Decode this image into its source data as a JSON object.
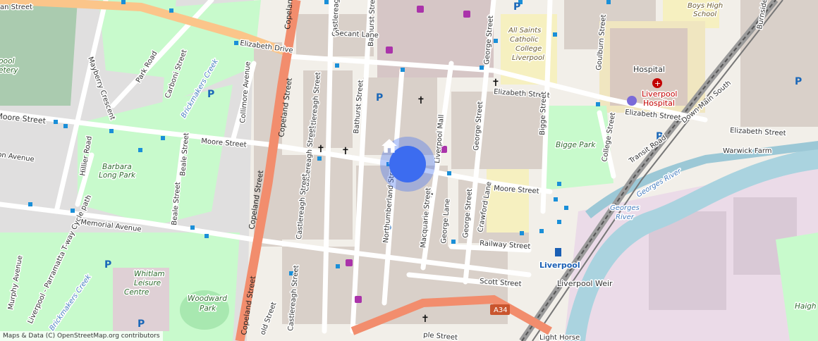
{
  "attribution": "Maps & Data (C) OpenStreetMap.org contributors",
  "colors": {
    "background": "#f2efe9",
    "park": "#c8facc",
    "building": "#d9d0c9",
    "primary_road": "#f28d6d",
    "secondary_road": "#f9d7a8",
    "water": "#aad3df",
    "rail": "#707070",
    "marker": "#3c6cf0"
  },
  "marker": {
    "icon": "home-icon"
  },
  "streets": {
    "moore_w": "Moore Street",
    "moore_c": "Moore Street",
    "moore_e": "Moore Street",
    "elizabeth_drive": "Elizabeth Drive",
    "elizabeth_c": "Elizabeth Street",
    "elizabeth_e1": "Elizabeth Street",
    "elizabeth_e2": "Elizabeth Street",
    "copeland_n": "Copeland Street",
    "copeland_c": "Copeland Street",
    "copeland_s": "Copeland Street",
    "memorial": "Memorial Avenue",
    "castlereagh_n": "Castlereagh Street",
    "castlereagh_c": "Castlereagh Street",
    "castlereagh_m": "Castlereagh Street",
    "castlereagh_s": "Castlereagh Street",
    "bathurst_n": "Bathurst Street",
    "bathurst_c": "Bathurst Street",
    "northumberland": "Northumberland Street",
    "macquarie": "Macquarie Street",
    "george_lane": "George Lane",
    "george_n": "George Street",
    "george_c": "George Street",
    "george_s": "George Street",
    "crawford": "Crawford Lane",
    "railway": "Railway Street",
    "scott": "Scott Street",
    "liverpool_mall": "Liverpool Mall",
    "secant": "Secant Lane",
    "bigge": "Bigge Street",
    "college": "College Street",
    "goulburn": "Goulburn Street",
    "burnside": "Burnside Drive",
    "mayberry": "Mayberry Crescent",
    "park_road": "Park Road",
    "carboni": "Carboni Street",
    "collimore": "Collimore Avenue",
    "hillier": "Hillier Road",
    "beale1": "Beale Street",
    "beale2": "Beale Street",
    "murphy": "Murphy Avenue",
    "avenue_w": "on Avenue",
    "street_nw": "an Street",
    "down_main_south": "Down Main South",
    "transit_road": "Transit Road",
    "warwick_farm": "Warwick Farm",
    "light_horse": "Light Horse",
    "cycle_path": "Liverpool - Parramatta T-way Cycle path",
    "ld_street": "old Street",
    "ple_street": "ple Street"
  },
  "areas": {
    "cemetery": "pool\netery",
    "barbara_long_park": "Barbara Long Park",
    "brickmakers_creek_n": "Brickmakers Creek",
    "brickmakers_creek_s": "Brickmakers Creek",
    "whitlam_leisure_centre": "Whitlam Leisure Centre",
    "woodward_park": "Woodward Park",
    "bigge_park": "Bigge Park",
    "all_saints": "All Saints Catholic College Liverpool",
    "boys_high": "Boys High School",
    "hospital": "Hospital",
    "liverpool_hospital": "Liverpool Hospital",
    "georges_river_1": "Georges River",
    "georges_river_2": "Georges River",
    "liverpool_station": "Liverpool",
    "liverpool_weir": "Liverpool Weir",
    "haigh": "Haigh",
    "route_a34": "A34"
  }
}
